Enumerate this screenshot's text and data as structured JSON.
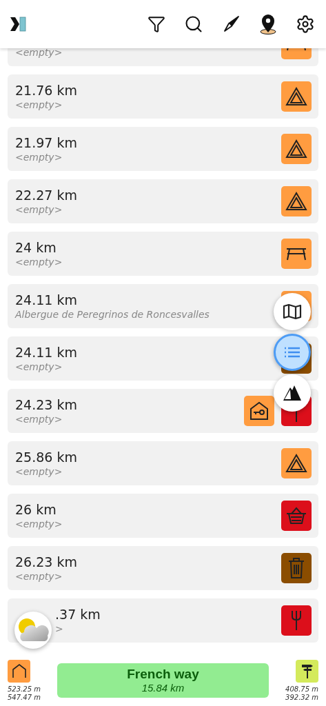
{
  "header": {
    "actions": [
      {
        "kind": "filter"
      },
      {
        "kind": "search"
      },
      {
        "kind": "compass"
      },
      {
        "kind": "location"
      },
      {
        "kind": "settings"
      }
    ]
  },
  "items": [
    {
      "subtitle": "<empty>",
      "icons": [
        {
          "kind": "picnic-table",
          "color": "#ff9c40"
        }
      ]
    },
    {
      "distance": "21.76 km",
      "subtitle": "<empty>",
      "icons": [
        {
          "kind": "tent",
          "color": "#ff9c40"
        }
      ]
    },
    {
      "distance": "21.97 km",
      "subtitle": "<empty>",
      "icons": [
        {
          "kind": "tent",
          "color": "#ff9c40"
        }
      ]
    },
    {
      "distance": "22.27 km",
      "subtitle": "<empty>",
      "icons": [
        {
          "kind": "tent",
          "color": "#ff9c40"
        }
      ]
    },
    {
      "distance": "24 km",
      "subtitle": "<empty>",
      "icons": [
        {
          "kind": "picnic-table",
          "color": "#ff9c40"
        }
      ]
    },
    {
      "distance": "24.11 km",
      "subtitle": "Albergue de Peregrinos de Roncesvalles",
      "icons": [
        {
          "kind": "covered",
          "color": "#ff9c40"
        }
      ]
    },
    {
      "distance": "24.11 km",
      "subtitle": "<empty>",
      "icons": [
        {
          "kind": "covered",
          "color": "#8b4d00"
        }
      ]
    },
    {
      "distance": "24.23 km",
      "subtitle": "<empty>",
      "icons": [
        {
          "kind": "house-key",
          "color": "#ff9c40"
        },
        {
          "kind": "pole",
          "color": "#dc0f1b"
        }
      ]
    },
    {
      "distance": "25.86 km",
      "subtitle": "<empty>",
      "icons": [
        {
          "kind": "tent",
          "color": "#ff9c40"
        }
      ]
    },
    {
      "distance": "26 km",
      "subtitle": "<empty>",
      "icons": [
        {
          "kind": "basket",
          "color": "#dc0f1b"
        }
      ]
    },
    {
      "distance": "26.23 km",
      "subtitle": "<empty>",
      "icons": [
        {
          "kind": "trash",
          "color": "#8b4d00"
        }
      ]
    },
    {
      "distance": ".37 km",
      "subtitle": ">",
      "covered": true,
      "icons": [
        {
          "kind": "fork",
          "color": "#dc0f1b"
        }
      ]
    }
  ],
  "view_buttons": [
    {
      "kind": "map",
      "selected": false
    },
    {
      "kind": "list",
      "selected": true
    },
    {
      "kind": "elevation",
      "selected": false
    }
  ],
  "bottom_bar": {
    "start": {
      "color": "#ff9c40",
      "line_1": "523.25 m",
      "line_2": "547.47 m"
    },
    "route": {
      "title": "French way",
      "distance": "15.84 km"
    },
    "end": {
      "color": "#d4ea5c",
      "line_1": "408.75 m",
      "line_2": "392.32 m"
    }
  }
}
